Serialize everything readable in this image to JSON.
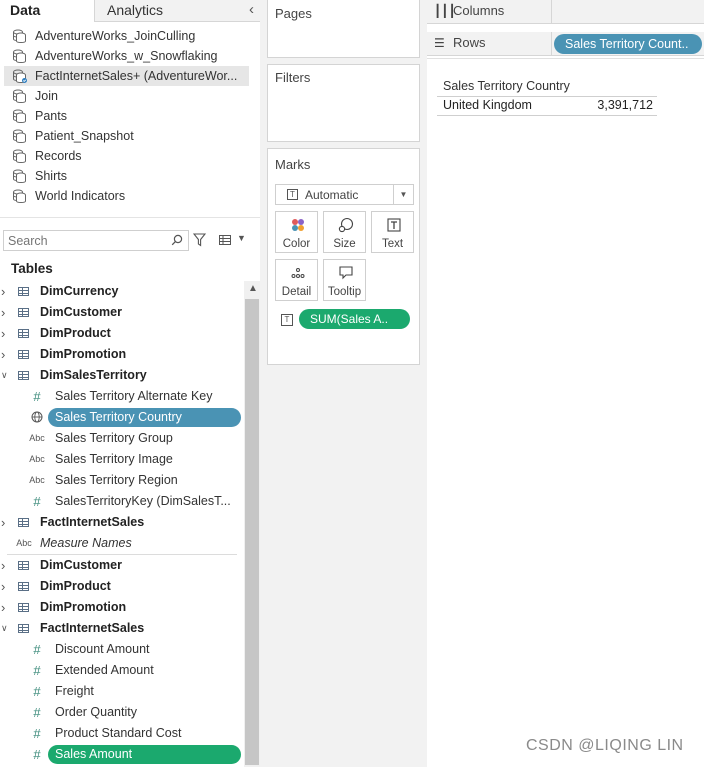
{
  "tabs": {
    "data": "Data",
    "analytics": "Analytics"
  },
  "datasources": [
    {
      "name": "AdventureWorks_JoinCulling",
      "selected": false
    },
    {
      "name": "AdventureWorks_w_Snowflaking",
      "selected": false
    },
    {
      "name": "FactInternetSales+ (AdventureWor...",
      "selected": true
    },
    {
      "name": "Join",
      "selected": false
    },
    {
      "name": "Pants",
      "selected": false
    },
    {
      "name": "Patient_Snapshot",
      "selected": false
    },
    {
      "name": "Records",
      "selected": false
    },
    {
      "name": "Shirts",
      "selected": false
    },
    {
      "name": "World Indicators",
      "selected": false
    }
  ],
  "search": {
    "placeholder": "Search"
  },
  "tables_title": "Tables",
  "tree": [
    {
      "kind": "table",
      "label": "DimCurrency",
      "expander": "collapsed"
    },
    {
      "kind": "table",
      "label": "DimCustomer",
      "expander": "collapsed"
    },
    {
      "kind": "table",
      "label": "DimProduct",
      "expander": "collapsed"
    },
    {
      "kind": "table",
      "label": "DimPromotion",
      "expander": "collapsed"
    },
    {
      "kind": "table",
      "label": "DimSalesTerritory",
      "expander": "expanded"
    },
    {
      "kind": "field",
      "type": "number",
      "label": "Sales Territory Alternate Key"
    },
    {
      "kind": "field",
      "type": "geo",
      "label": "Sales Territory Country",
      "pill": "#4a93b4"
    },
    {
      "kind": "field",
      "type": "string",
      "label": "Sales Territory Group"
    },
    {
      "kind": "field",
      "type": "string",
      "label": "Sales Territory Image"
    },
    {
      "kind": "field",
      "type": "string",
      "label": "Sales Territory Region"
    },
    {
      "kind": "field",
      "type": "number",
      "label": "SalesTerritoryKey (DimSalesT..."
    },
    {
      "kind": "table",
      "label": "FactInternetSales",
      "expander": "collapsed"
    },
    {
      "kind": "top",
      "type": "string",
      "label": "Measure Names"
    },
    {
      "kind": "sep"
    },
    {
      "kind": "table",
      "label": "DimCustomer",
      "expander": "collapsed"
    },
    {
      "kind": "table",
      "label": "DimProduct",
      "expander": "collapsed"
    },
    {
      "kind": "table",
      "label": "DimPromotion",
      "expander": "collapsed"
    },
    {
      "kind": "table",
      "label": "FactInternetSales",
      "expander": "expanded"
    },
    {
      "kind": "field",
      "type": "number",
      "label": "Discount Amount"
    },
    {
      "kind": "field",
      "type": "number",
      "label": "Extended Amount"
    },
    {
      "kind": "field",
      "type": "number",
      "label": "Freight"
    },
    {
      "kind": "field",
      "type": "number",
      "label": "Order Quantity"
    },
    {
      "kind": "field",
      "type": "number",
      "label": "Product Standard Cost"
    },
    {
      "kind": "field",
      "type": "number",
      "label": "Sales Amount",
      "pill": "#1ba96e"
    }
  ],
  "cards": {
    "pages": "Pages",
    "filters": "Filters",
    "marks": "Marks",
    "mark_type": "Automatic",
    "buttons": {
      "color": "Color",
      "size": "Size",
      "text": "Text",
      "detail": "Detail",
      "tooltip": "Tooltip"
    },
    "marks_pill": "SUM(Sales A..",
    "marks_pill_color": "#1ba96e"
  },
  "shelves": {
    "columns": "Columns",
    "rows": "Rows",
    "rows_pill": "Sales Territory Count..",
    "rows_pill_color": "#4a93b4"
  },
  "viz": {
    "header": "Sales Territory Country",
    "country": "United Kingdom",
    "value": "3,391,712"
  },
  "watermark": "CSDN @LIQING LIN"
}
